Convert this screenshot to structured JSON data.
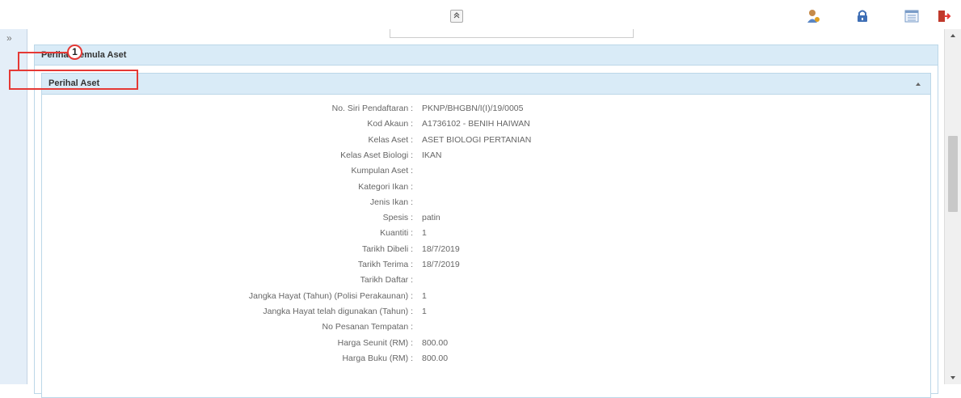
{
  "topbar": {
    "collapse_glyph": "»",
    "icons": [
      "user-settings-icon",
      "lock-icon",
      "list-view-icon",
      "logout-icon"
    ]
  },
  "rail": {
    "toggle_glyph": "»"
  },
  "panel_outer": {
    "title": "Perihal Pemula Aset"
  },
  "panel_inner": {
    "title": "Perihal Aset"
  },
  "annotation": {
    "step": "1",
    "color": "#e53935"
  },
  "fields": [
    {
      "label": "No. Siri Pendaftaran :",
      "value": "PKNP/BHGBN/I(I)/19/0005"
    },
    {
      "label": "Kod Akaun :",
      "value": "A1736102 - BENIH HAIWAN"
    },
    {
      "label": "Kelas Aset :",
      "value": "ASET BIOLOGI PERTANIAN"
    },
    {
      "label": "Kelas Aset Biologi :",
      "value": "IKAN"
    },
    {
      "label": "Kumpulan Aset :",
      "value": ""
    },
    {
      "label": "Kategori Ikan :",
      "value": ""
    },
    {
      "label": "Jenis Ikan :",
      "value": ""
    },
    {
      "label": "Spesis :",
      "value": "patin"
    },
    {
      "label": "Kuantiti :",
      "value": "1"
    },
    {
      "label": "Tarikh Dibeli :",
      "value": "18/7/2019"
    },
    {
      "label": "Tarikh Terima :",
      "value": "18/7/2019"
    },
    {
      "label": "Tarikh Daftar :",
      "value": ""
    },
    {
      "label": "Jangka Hayat (Tahun) (Polisi Perakaunan) :",
      "value": "1"
    },
    {
      "label": "Jangka Hayat telah digunakan (Tahun) :",
      "value": "1"
    },
    {
      "label": "No Pesanan Tempatan :",
      "value": ""
    },
    {
      "label": "Harga Seunit (RM) :",
      "value": "800.00"
    },
    {
      "label": "Harga Buku (RM) :",
      "value": "800.00"
    }
  ]
}
